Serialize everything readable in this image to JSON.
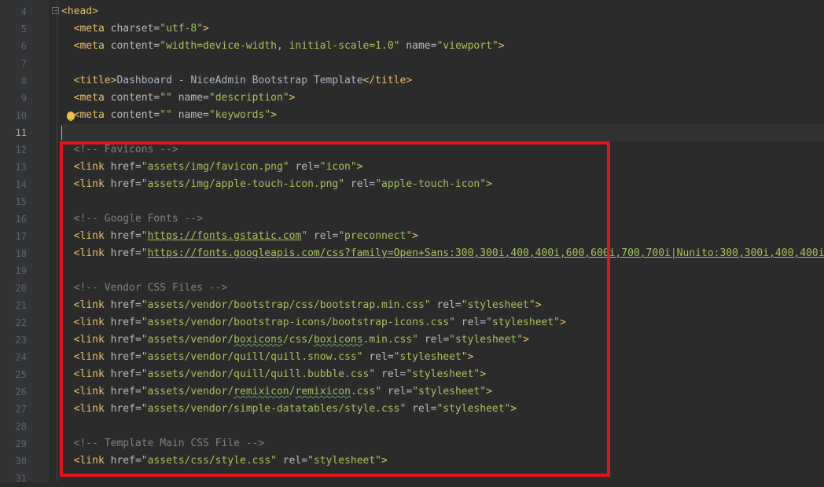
{
  "editor": {
    "lines": [
      {
        "num": "4",
        "indent": "",
        "tokens": [
          {
            "t": "tag",
            "v": "<head>"
          }
        ]
      },
      {
        "num": "5",
        "indent": "  ",
        "tokens": [
          {
            "t": "tag",
            "v": "<meta "
          },
          {
            "t": "attr",
            "v": "charset"
          },
          {
            "t": "text",
            "v": "="
          },
          {
            "t": "str",
            "v": "\"utf-8\""
          },
          {
            "t": "tag",
            "v": ">"
          }
        ]
      },
      {
        "num": "6",
        "indent": "  ",
        "tokens": [
          {
            "t": "tag",
            "v": "<meta "
          },
          {
            "t": "attr",
            "v": "content"
          },
          {
            "t": "text",
            "v": "="
          },
          {
            "t": "str",
            "v": "\"width=device-width, initial-scale=1.0\""
          },
          {
            "t": "text",
            "v": " "
          },
          {
            "t": "attr",
            "v": "name"
          },
          {
            "t": "text",
            "v": "="
          },
          {
            "t": "str",
            "v": "\"viewport\""
          },
          {
            "t": "tag",
            "v": ">"
          }
        ]
      },
      {
        "num": "7",
        "indent": "",
        "tokens": []
      },
      {
        "num": "8",
        "indent": "  ",
        "tokens": [
          {
            "t": "tag",
            "v": "<title>"
          },
          {
            "t": "text",
            "v": "Dashboard - NiceAdmin Bootstrap Template"
          },
          {
            "t": "tag",
            "v": "</title>"
          }
        ]
      },
      {
        "num": "9",
        "indent": "  ",
        "tokens": [
          {
            "t": "tag",
            "v": "<meta "
          },
          {
            "t": "attr",
            "v": "content"
          },
          {
            "t": "text",
            "v": "="
          },
          {
            "t": "str",
            "v": "\"\""
          },
          {
            "t": "text",
            "v": " "
          },
          {
            "t": "attr",
            "v": "name"
          },
          {
            "t": "text",
            "v": "="
          },
          {
            "t": "str",
            "v": "\"description\""
          },
          {
            "t": "tag",
            "v": ">"
          }
        ]
      },
      {
        "num": "10",
        "indent": "  ",
        "tokens": [
          {
            "t": "tag",
            "v": "<meta "
          },
          {
            "t": "attr",
            "v": "content"
          },
          {
            "t": "text",
            "v": "="
          },
          {
            "t": "str",
            "v": "\"\""
          },
          {
            "t": "text",
            "v": " "
          },
          {
            "t": "attr",
            "v": "name"
          },
          {
            "t": "text",
            "v": "="
          },
          {
            "t": "str",
            "v": "\"keywords\""
          },
          {
            "t": "tag",
            "v": ">"
          }
        ]
      },
      {
        "num": "11",
        "indent": "",
        "tokens": [],
        "current": true
      },
      {
        "num": "12",
        "indent": "  ",
        "tokens": [
          {
            "t": "comment",
            "v": "<!-- Favicons -->"
          }
        ]
      },
      {
        "num": "13",
        "indent": "  ",
        "tokens": [
          {
            "t": "tag",
            "v": "<link "
          },
          {
            "t": "attr",
            "v": "href"
          },
          {
            "t": "text",
            "v": "="
          },
          {
            "t": "str",
            "v": "\"assets/img/favicon.png\""
          },
          {
            "t": "text",
            "v": " "
          },
          {
            "t": "attr",
            "v": "rel"
          },
          {
            "t": "text",
            "v": "="
          },
          {
            "t": "str",
            "v": "\"icon\""
          },
          {
            "t": "tag",
            "v": ">"
          }
        ]
      },
      {
        "num": "14",
        "indent": "  ",
        "tokens": [
          {
            "t": "tag",
            "v": "<link "
          },
          {
            "t": "attr",
            "v": "href"
          },
          {
            "t": "text",
            "v": "="
          },
          {
            "t": "str",
            "v": "\"assets/img/apple-touch-icon.png\""
          },
          {
            "t": "text",
            "v": " "
          },
          {
            "t": "attr",
            "v": "rel"
          },
          {
            "t": "text",
            "v": "="
          },
          {
            "t": "str",
            "v": "\"apple-touch-icon\""
          },
          {
            "t": "tag",
            "v": ">"
          }
        ]
      },
      {
        "num": "15",
        "indent": "",
        "tokens": []
      },
      {
        "num": "16",
        "indent": "  ",
        "tokens": [
          {
            "t": "comment",
            "v": "<!-- Google Fonts -->"
          }
        ]
      },
      {
        "num": "17",
        "indent": "  ",
        "tokens": [
          {
            "t": "tag",
            "v": "<link "
          },
          {
            "t": "attr",
            "v": "href"
          },
          {
            "t": "text",
            "v": "="
          },
          {
            "t": "str",
            "v": "\""
          },
          {
            "t": "str url",
            "v": "https://fonts.gstatic.com"
          },
          {
            "t": "str",
            "v": "\""
          },
          {
            "t": "text",
            "v": " "
          },
          {
            "t": "attr",
            "v": "rel"
          },
          {
            "t": "text",
            "v": "="
          },
          {
            "t": "str",
            "v": "\"preconnect\""
          },
          {
            "t": "tag",
            "v": ">"
          }
        ]
      },
      {
        "num": "18",
        "indent": "  ",
        "tokens": [
          {
            "t": "tag",
            "v": "<link "
          },
          {
            "t": "attr",
            "v": "href"
          },
          {
            "t": "text",
            "v": "="
          },
          {
            "t": "str",
            "v": "\""
          },
          {
            "t": "str url",
            "v": "https://fonts.googleapis.com/css?family=Open+Sans:300,300i,400,400i,600,600i,700,700i|Nunito:300,300i,400,400i"
          }
        ]
      },
      {
        "num": "19",
        "indent": "",
        "tokens": []
      },
      {
        "num": "20",
        "indent": "  ",
        "tokens": [
          {
            "t": "comment",
            "v": "<!-- Vendor CSS Files -->"
          }
        ]
      },
      {
        "num": "21",
        "indent": "  ",
        "tokens": [
          {
            "t": "tag",
            "v": "<link "
          },
          {
            "t": "attr",
            "v": "href"
          },
          {
            "t": "text",
            "v": "="
          },
          {
            "t": "str",
            "v": "\"assets/vendor/bootstrap/css/bootstrap.min.css\""
          },
          {
            "t": "text",
            "v": " "
          },
          {
            "t": "attr",
            "v": "rel"
          },
          {
            "t": "text",
            "v": "="
          },
          {
            "t": "str",
            "v": "\"stylesheet\""
          },
          {
            "t": "tag",
            "v": ">"
          }
        ]
      },
      {
        "num": "22",
        "indent": "  ",
        "tokens": [
          {
            "t": "tag",
            "v": "<link "
          },
          {
            "t": "attr",
            "v": "href"
          },
          {
            "t": "text",
            "v": "="
          },
          {
            "t": "str",
            "v": "\"assets/vendor/bootstrap-icons/bootstrap-icons.css\""
          },
          {
            "t": "text",
            "v": " "
          },
          {
            "t": "attr",
            "v": "rel"
          },
          {
            "t": "text",
            "v": "="
          },
          {
            "t": "str",
            "v": "\"stylesheet\""
          },
          {
            "t": "tag",
            "v": ">"
          }
        ]
      },
      {
        "num": "23",
        "indent": "  ",
        "tokens": [
          {
            "t": "tag",
            "v": "<link "
          },
          {
            "t": "attr",
            "v": "href"
          },
          {
            "t": "text",
            "v": "="
          },
          {
            "t": "str",
            "v": "\"assets/vendor/"
          },
          {
            "t": "str typo",
            "v": "boxicons"
          },
          {
            "t": "str",
            "v": "/css/"
          },
          {
            "t": "str typo",
            "v": "boxicons"
          },
          {
            "t": "str",
            "v": ".min.css\""
          },
          {
            "t": "text",
            "v": " "
          },
          {
            "t": "attr",
            "v": "rel"
          },
          {
            "t": "text",
            "v": "="
          },
          {
            "t": "str",
            "v": "\"stylesheet\""
          },
          {
            "t": "tag",
            "v": ">"
          }
        ]
      },
      {
        "num": "24",
        "indent": "  ",
        "tokens": [
          {
            "t": "tag",
            "v": "<link "
          },
          {
            "t": "attr",
            "v": "href"
          },
          {
            "t": "text",
            "v": "="
          },
          {
            "t": "str",
            "v": "\"assets/vendor/quill/quill.snow.css\""
          },
          {
            "t": "text",
            "v": " "
          },
          {
            "t": "attr",
            "v": "rel"
          },
          {
            "t": "text",
            "v": "="
          },
          {
            "t": "str",
            "v": "\"stylesheet\""
          },
          {
            "t": "tag",
            "v": ">"
          }
        ]
      },
      {
        "num": "25",
        "indent": "  ",
        "tokens": [
          {
            "t": "tag",
            "v": "<link "
          },
          {
            "t": "attr",
            "v": "href"
          },
          {
            "t": "text",
            "v": "="
          },
          {
            "t": "str",
            "v": "\"assets/vendor/quill/quill.bubble.css\""
          },
          {
            "t": "text",
            "v": " "
          },
          {
            "t": "attr",
            "v": "rel"
          },
          {
            "t": "text",
            "v": "="
          },
          {
            "t": "str",
            "v": "\"stylesheet\""
          },
          {
            "t": "tag",
            "v": ">"
          }
        ]
      },
      {
        "num": "26",
        "indent": "  ",
        "tokens": [
          {
            "t": "tag",
            "v": "<link "
          },
          {
            "t": "attr",
            "v": "href"
          },
          {
            "t": "text",
            "v": "="
          },
          {
            "t": "str",
            "v": "\"assets/vendor/"
          },
          {
            "t": "str typo",
            "v": "remixicon"
          },
          {
            "t": "str",
            "v": "/"
          },
          {
            "t": "str typo",
            "v": "remixicon"
          },
          {
            "t": "str",
            "v": ".css\""
          },
          {
            "t": "text",
            "v": " "
          },
          {
            "t": "attr",
            "v": "rel"
          },
          {
            "t": "text",
            "v": "="
          },
          {
            "t": "str",
            "v": "\"stylesheet\""
          },
          {
            "t": "tag",
            "v": ">"
          }
        ]
      },
      {
        "num": "27",
        "indent": "  ",
        "tokens": [
          {
            "t": "tag",
            "v": "<link "
          },
          {
            "t": "attr",
            "v": "href"
          },
          {
            "t": "text",
            "v": "="
          },
          {
            "t": "str",
            "v": "\"assets/vendor/simple-datatables/style.css\""
          },
          {
            "t": "text",
            "v": " "
          },
          {
            "t": "attr",
            "v": "rel"
          },
          {
            "t": "text",
            "v": "="
          },
          {
            "t": "str",
            "v": "\"stylesheet\""
          },
          {
            "t": "tag",
            "v": ">"
          }
        ]
      },
      {
        "num": "28",
        "indent": "",
        "tokens": []
      },
      {
        "num": "29",
        "indent": "  ",
        "tokens": [
          {
            "t": "comment",
            "v": "<!-- Template Main CSS File -->"
          }
        ]
      },
      {
        "num": "30",
        "indent": "  ",
        "tokens": [
          {
            "t": "tag",
            "v": "<link "
          },
          {
            "t": "attr",
            "v": "href"
          },
          {
            "t": "text",
            "v": "="
          },
          {
            "t": "str",
            "v": "\"assets/css/style.css\""
          },
          {
            "t": "text",
            "v": " "
          },
          {
            "t": "attr",
            "v": "rel"
          },
          {
            "t": "text",
            "v": "="
          },
          {
            "t": "str",
            "v": "\"stylesheet\""
          },
          {
            "t": "tag",
            "v": ">"
          }
        ]
      },
      {
        "num": "31",
        "indent": "",
        "tokens": []
      }
    ],
    "colors": {
      "background": "#2b2b2b",
      "gutter": "#313335",
      "tag": "#e8bf6a",
      "attribute": "#bababa",
      "string": "#a5c25c",
      "comment": "#808080",
      "highlight_box": "#e3141b"
    },
    "icons": {
      "fold": "fold-marker-icon",
      "intention": "lightbulb-icon"
    }
  }
}
